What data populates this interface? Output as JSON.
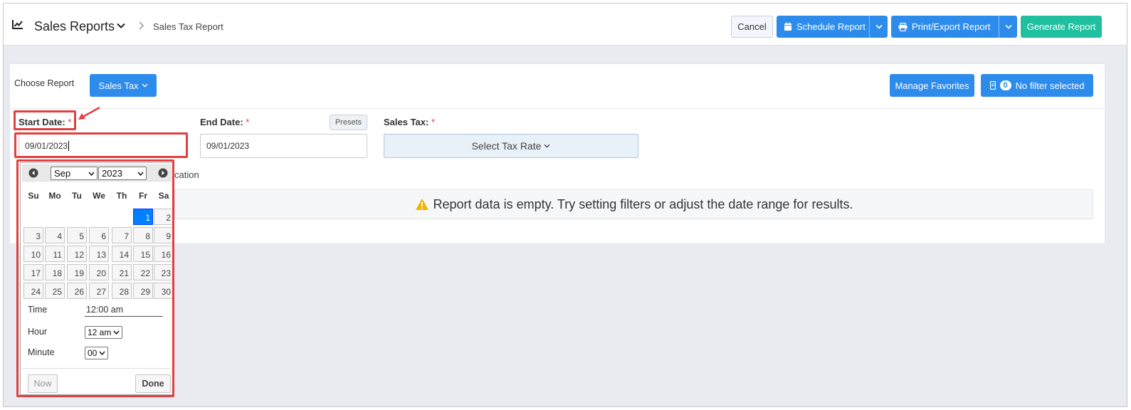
{
  "header": {
    "app_title": "Sales Reports",
    "breadcrumb": "Sales Tax Report",
    "buttons": {
      "cancel": "Cancel",
      "schedule": "Schedule Report",
      "print_export": "Print/Export Report",
      "generate": "Generate Report"
    }
  },
  "toolbar": {
    "choose_report_label": "Choose Report",
    "report_dropdown": "Sales Tax",
    "manage_favorites": "Manage Favorites",
    "filter_count": "0",
    "filter_text": "No filter selected"
  },
  "form": {
    "start_date_label": "Start Date:",
    "end_date_label": "End Date:",
    "sales_tax_label": "Sales Tax:",
    "required_mark": "*",
    "presets": "Presets",
    "start_date_value": "09/01/2023",
    "end_date_value": "09/01/2023",
    "tax_select": "Select Tax Rate",
    "partial_text": "cation",
    "empty_message": "Report data is empty. Try setting filters or adjust the date range for results."
  },
  "datepicker": {
    "month": "Sep",
    "year": "2023",
    "weekdays": [
      "Su",
      "Mo",
      "Tu",
      "We",
      "Th",
      "Fr",
      "Sa"
    ],
    "selected_day": 1,
    "days": [
      [
        "",
        "",
        "",
        "",
        "",
        "1",
        "2"
      ],
      [
        "3",
        "4",
        "5",
        "6",
        "7",
        "8",
        "9"
      ],
      [
        "10",
        "11",
        "12",
        "13",
        "14",
        "15",
        "16"
      ],
      [
        "17",
        "18",
        "19",
        "20",
        "21",
        "22",
        "23"
      ],
      [
        "24",
        "25",
        "26",
        "27",
        "28",
        "29",
        "30"
      ]
    ],
    "time_label": "Time",
    "time_value": "12:00 am",
    "hour_label": "Hour",
    "hour_value": "12 am",
    "minute_label": "Minute",
    "minute_value": "00",
    "now_button": "Now",
    "done_button": "Done"
  },
  "colors": {
    "primary": "#2d8ceb",
    "success": "#1fbf9f",
    "annotation_red": "#e04040",
    "active_day": "#007fff",
    "warning": "#f0b400"
  }
}
